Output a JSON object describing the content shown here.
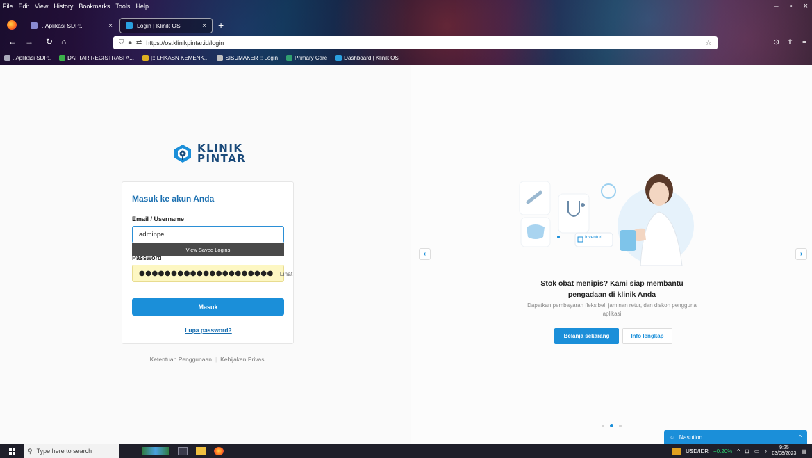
{
  "browser": {
    "menu": [
      "File",
      "Edit",
      "View",
      "History",
      "Bookmarks",
      "Tools",
      "Help"
    ],
    "tabs": [
      {
        "title": ".:Aplikasi SDP:.",
        "close": "×"
      },
      {
        "title": "Login | Klinik OS",
        "close": "×"
      }
    ],
    "new_tab": "+",
    "url": "https://os.klinikpintar.id/login",
    "bookmarks": [
      ".:Aplikasi SDP:.",
      "DAFTAR REGISTRASI A...",
      "|:: LHKASN KEMENK...",
      "SISUMAKER :: Login",
      "Primary Care",
      "Dashboard | Klinik OS"
    ],
    "window_controls": [
      "–",
      "▫",
      "×"
    ]
  },
  "logo": {
    "line1": "KLINIK",
    "line2": "PINTAR"
  },
  "login": {
    "title": "Masuk ke akun Anda",
    "email_label": "Email / Username",
    "email_value": "adminpe",
    "saved_logins": "View Saved Logins",
    "password_label": "Password",
    "password_mask": "●●●●●●●●●●●●●●●●●●●●●",
    "show_password": "Lihat",
    "submit": "Masuk",
    "forgot": "Lupa password?"
  },
  "footer": {
    "terms": "Ketentuan Penggunaan",
    "privacy": "Kebijakan Privasi",
    "separator": "|"
  },
  "promo": {
    "badge": "Inventori",
    "title": "Stok obat menipis? Kami siap membantu pengadaan di klinik Anda",
    "subtitle": "Dapatkan pembayaran fleksibel, jaminan retur, dan diskon pengguna aplikasi",
    "primary_button": "Belanja sekarang",
    "secondary_button": "Info lengkap",
    "prev": "‹",
    "next": "›",
    "slide_count": 3,
    "active_slide": 2
  },
  "chat": {
    "name": "Nasution",
    "toggle": "^"
  },
  "taskbar": {
    "search_placeholder": "Type here to search",
    "ticker": "USD/IDR",
    "ticker_change": "+0.20%",
    "time": "9:25",
    "date": "03/08/2023"
  },
  "colors": {
    "primary": "#1b8fd9",
    "brand_dark": "#1a4a7a",
    "autofill": "#fdf7c3"
  }
}
